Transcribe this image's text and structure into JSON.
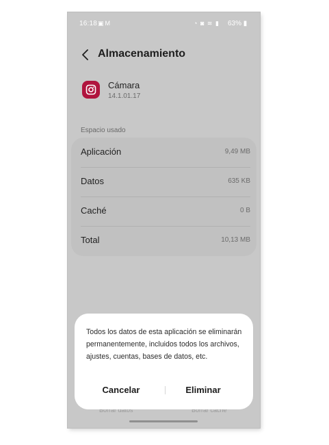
{
  "status_bar": {
    "time": "16:18",
    "left_icons": [
      "image-icon",
      "mail-icon"
    ],
    "right_icons": [
      "alarm-icon",
      "do-not-disturb-icon",
      "wifi-icon",
      "signal-icon"
    ],
    "battery": "63%"
  },
  "header": {
    "title": "Almacenamiento"
  },
  "app": {
    "name": "Cámara",
    "version": "14.1.01.17",
    "icon_color": "#b0143e"
  },
  "storage": {
    "section_label": "Espacio usado",
    "rows": [
      {
        "label": "Aplicación",
        "value": "9,49 MB"
      },
      {
        "label": "Datos",
        "value": "635 KB"
      },
      {
        "label": "Caché",
        "value": "0 B"
      },
      {
        "label": "Total",
        "value": "10,13 MB"
      }
    ]
  },
  "bottom_actions": {
    "clear_data": "Borrar datos",
    "clear_cache": "Borrar caché"
  },
  "dialog": {
    "message": "Todos los datos de esta aplicación se eliminarán permanentemente, incluidos todos los archivos, ajustes, cuentas, bases de datos, etc.",
    "cancel_label": "Cancelar",
    "delete_label": "Eliminar"
  }
}
